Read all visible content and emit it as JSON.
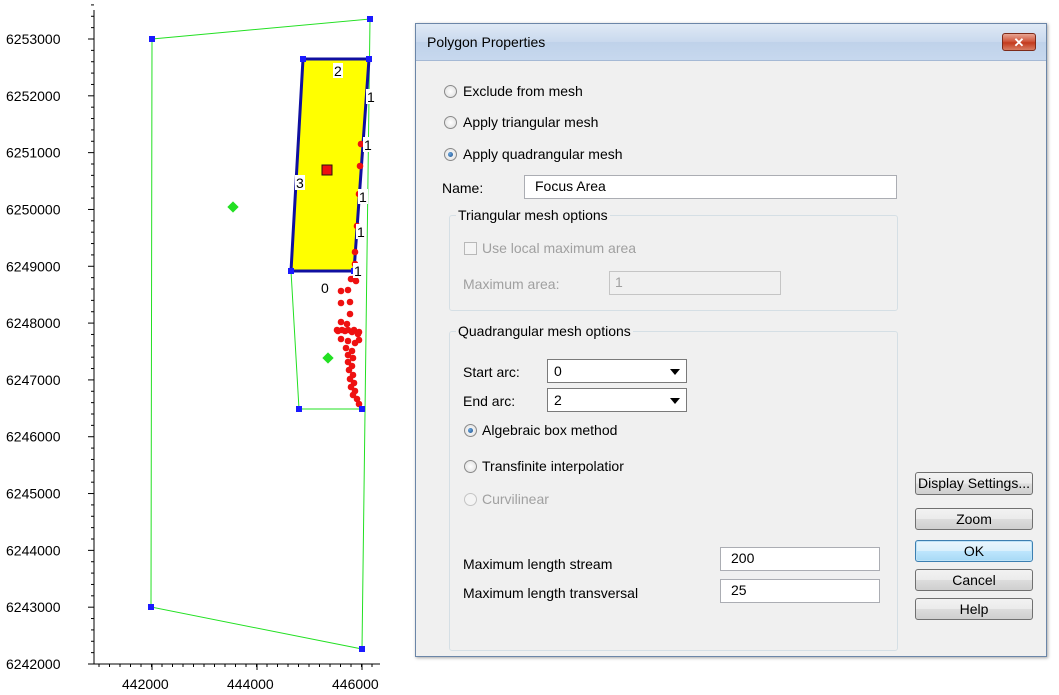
{
  "plot": {
    "y_ticks": [
      "6242000",
      "6243000",
      "6244000",
      "6245000",
      "6246000",
      "6247000",
      "6248000",
      "6249000",
      "6250000",
      "6251000",
      "6252000",
      "6253000"
    ],
    "x_ticks": [
      "442000",
      "444000",
      "446000"
    ],
    "arc_labels": [
      "2",
      "1",
      "1",
      "3",
      "1",
      "1",
      "1",
      "0"
    ],
    "colors": {
      "outer_boundary": "#22e022",
      "vertex": "#1a1aff",
      "focus_fill": "#ffff00",
      "focus_border": "#1010a0",
      "points": "#ee1010",
      "centroid": "#22e022"
    }
  },
  "dialog": {
    "title": "Polygon Properties",
    "close_label": "✕",
    "radios": {
      "exclude": "Exclude from mesh",
      "triangular": "Apply triangular mesh",
      "quadrangular": "Apply quadrangular mesh"
    },
    "name_label": "Name:",
    "name_value": "Focus Area",
    "tri_group": {
      "title": "Triangular mesh options",
      "use_local_max": "Use local maximum area",
      "max_area_label": "Maximum area:",
      "max_area_value": "1"
    },
    "quad_group": {
      "title": "Quadrangular mesh options",
      "start_arc_label": "Start arc:",
      "start_arc_value": "0",
      "end_arc_label": "End arc:",
      "end_arc_value": "2",
      "algebraic": "Algebraic box method",
      "transfinite": "Transfinite interpolatior",
      "curvilinear": "Curvilinear",
      "max_len_stream_label": "Maximum length stream",
      "max_len_stream_value": "200",
      "max_len_trans_label": "Maximum length transversal",
      "max_len_trans_value": "25"
    },
    "buttons": {
      "display_settings": "Display Settings...",
      "zoom": "Zoom",
      "ok": "OK",
      "cancel": "Cancel",
      "help": "Help"
    }
  }
}
